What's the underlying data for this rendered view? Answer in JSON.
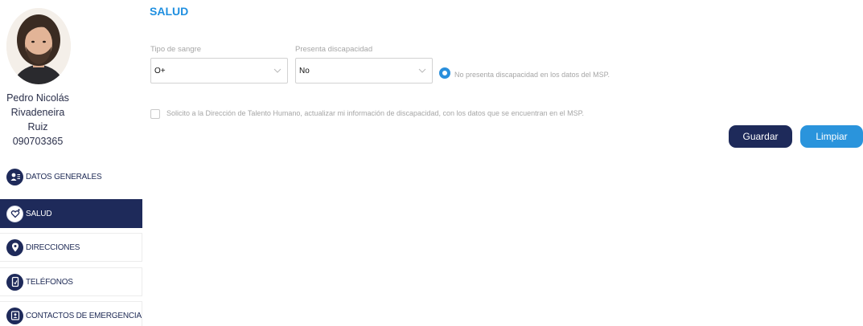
{
  "user": {
    "first_line": "Pedro Nicolás",
    "second_line": "Rivadeneira Ruiz",
    "id_number": "090703365"
  },
  "sidebar": {
    "items": [
      {
        "label": "DATOS GENERALES",
        "icon": "person-card-icon",
        "active": false
      },
      {
        "label": "SALUD",
        "icon": "stethoscope-heart-icon",
        "active": true
      },
      {
        "label": "DIRECCIONES",
        "icon": "map-pin-icon",
        "active": false
      },
      {
        "label": "TELÉFONOS",
        "icon": "phone-icon",
        "active": false
      },
      {
        "label": "CONTACTOS DE EMERGENCIA",
        "icon": "contact-book-icon",
        "active": false
      }
    ]
  },
  "main": {
    "title": "SALUD",
    "blood_type": {
      "label": "Tipo de sangre",
      "value": "O+"
    },
    "disability": {
      "label": "Presenta discapacidad",
      "value": "No"
    },
    "msp_info": "No presenta discapacidad en los datos del MSP.",
    "request_checkbox": {
      "label": "Solicito a la Dirección de Talento Humano, actualizar mi información de discapacidad, con los datos que se encuentran en el MSP.",
      "checked": false
    },
    "buttons": {
      "save": "Guardar",
      "clear": "Limpiar"
    }
  },
  "colors": {
    "navy": "#1e2a5a",
    "accent_blue": "#2a94dc",
    "title_blue": "#1f8fe0",
    "muted_text": "#a6a6a6"
  }
}
